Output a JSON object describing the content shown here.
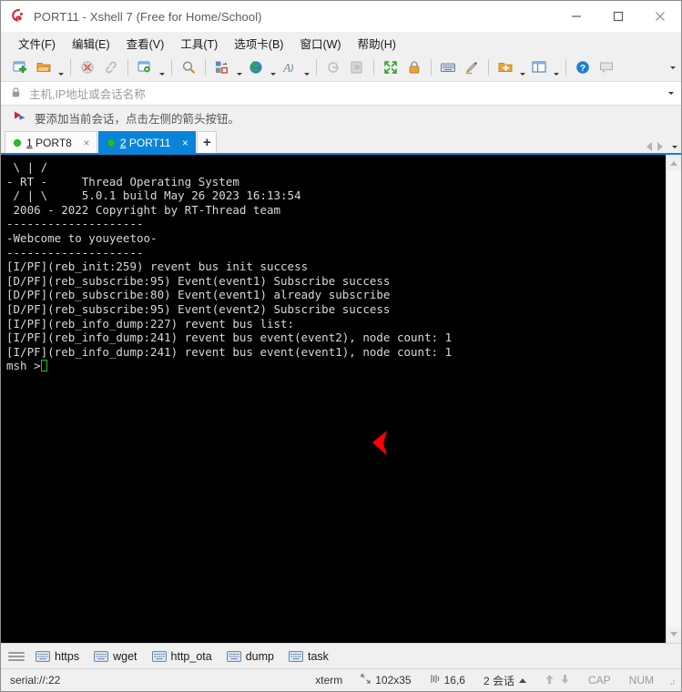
{
  "window": {
    "title": "PORT11 - Xshell 7 (Free for Home/School)",
    "logo_icon": "xshell-logo-icon",
    "minimize_icon": "minimize-icon",
    "maximize_icon": "maximize-icon",
    "close_icon": "close-icon",
    "minimize_glyph": "—",
    "maximize_glyph": "☐",
    "close_glyph": "✕"
  },
  "menu": {
    "items": [
      {
        "label": "文件(F)",
        "name": "menu-file"
      },
      {
        "label": "编辑(E)",
        "name": "menu-edit"
      },
      {
        "label": "查看(V)",
        "name": "menu-view"
      },
      {
        "label": "工具(T)",
        "name": "menu-tools"
      },
      {
        "label": "选项卡(B)",
        "name": "menu-tabs"
      },
      {
        "label": "窗口(W)",
        "name": "menu-window"
      },
      {
        "label": "帮助(H)",
        "name": "menu-help"
      }
    ]
  },
  "toolbar": {
    "buttons": [
      {
        "name": "new-session-icon",
        "has_caret": false
      },
      {
        "name": "open-session-icon",
        "has_caret": true
      },
      {
        "name": "disconnect-icon",
        "has_caret": false
      },
      {
        "name": "reconnect-icon",
        "has_caret": false
      },
      {
        "name": "session-properties-icon",
        "has_caret": true
      },
      {
        "name": "find-icon",
        "has_caret": false
      },
      {
        "name": "layout-icon",
        "has_caret": true
      },
      {
        "name": "globe-encoding-icon",
        "has_caret": true
      },
      {
        "name": "font-icon",
        "has_caret": true
      },
      {
        "name": "clear-screen-icon",
        "has_caret": false
      },
      {
        "name": "paste-icon",
        "has_caret": false
      },
      {
        "name": "fullscreen-icon",
        "has_caret": false
      },
      {
        "name": "lock-icon",
        "has_caret": false
      },
      {
        "name": "keyboard-icon",
        "has_caret": false
      },
      {
        "name": "highlight-icon",
        "has_caret": false
      },
      {
        "name": "new-folder-icon",
        "has_caret": true
      },
      {
        "name": "split-view-icon",
        "has_caret": true
      },
      {
        "name": "help-icon",
        "has_caret": false
      },
      {
        "name": "chat-icon",
        "has_caret": false
      }
    ],
    "overflow_icon": "toolbar-overflow-icon"
  },
  "address_bar": {
    "lock_icon": "lock-icon",
    "placeholder": "主机,IP地址或会话名称",
    "value": "",
    "dropdown_icon": "chevron-down-icon"
  },
  "notice": {
    "icon": "red-blue-arrow-icon",
    "text": "要添加当前会话，点击左侧的箭头按钮。"
  },
  "tabs": {
    "items": [
      {
        "index": "1",
        "label": "PORT8",
        "active": false,
        "status": "connected",
        "close_glyph": "×"
      },
      {
        "index": "2",
        "label": "PORT11",
        "active": true,
        "status": "connected",
        "close_glyph": "×"
      }
    ],
    "add_label": "+",
    "prev_icon": "tab-prev-icon",
    "next_icon": "tab-next-icon",
    "list_icon": "tab-list-icon"
  },
  "terminal": {
    "lines": [
      {
        "text": " \\ | /",
        "color": "white"
      },
      {
        "text": "- RT -     Thread Operating System",
        "color": "white"
      },
      {
        "text": " / | \\     5.0.1 build May 26 2023 16:13:54",
        "color": "white"
      },
      {
        "text": " 2006 - 2022 Copyright by RT-Thread team",
        "color": "white"
      },
      {
        "text": "--------------------",
        "color": "white"
      },
      {
        "text": "-Webcome to youyeetoo-",
        "color": "white"
      },
      {
        "text": "--------------------",
        "color": "white"
      },
      {
        "text": "[I/PF](reb_init:259) revent bus init success",
        "color": "green"
      },
      {
        "text": "[D/PF](reb_subscribe:95) Event(event1) Subscribe success",
        "color": "white"
      },
      {
        "text": "[D/PF](reb_subscribe:80) Event(event1) already subscribe",
        "color": "white"
      },
      {
        "text": "[D/PF](reb_subscribe:95) Event(event2) Subscribe success",
        "color": "white"
      },
      {
        "text": "[I/PF](reb_info_dump:227) revent bus list:",
        "color": "green"
      },
      {
        "text": "[I/PF](reb_info_dump:241) revent bus event(event2), node count: 1",
        "color": "green"
      },
      {
        "text": "[I/PF](reb_info_dump:241) revent bus event(event1), node count: 1",
        "color": "green"
      }
    ],
    "prompt": "msh >",
    "annotation": {
      "name": "red-arrow-annotation",
      "color": "#ff0000"
    },
    "colors": {
      "background": "#000000",
      "green": "#13a10e",
      "white": "#cccccc",
      "cursor": "#19c819"
    },
    "scrollbar": {
      "up_icon": "scroll-up-icon",
      "down_icon": "scroll-down-icon"
    }
  },
  "quick_commands": {
    "handle_icon": "drag-handle-icon",
    "items": [
      {
        "label": "https",
        "icon": "keyboard-icon"
      },
      {
        "label": "wget",
        "icon": "keyboard-icon"
      },
      {
        "label": "http_ota",
        "icon": "keyboard-icon"
      },
      {
        "label": "dump",
        "icon": "keyboard-icon"
      },
      {
        "label": "task",
        "icon": "keyboard-icon"
      }
    ]
  },
  "status_bar": {
    "connection": "serial://:22",
    "term_type": "xterm",
    "size_icon": "screen-size-icon",
    "size": "102x35",
    "cursor_icon": "cursor-position-icon",
    "cursor_pos": "16,6",
    "sessions": "2 会话",
    "up_icon": "upload-icon",
    "down_icon": "download-icon",
    "caps": "CAP",
    "num": "NUM"
  }
}
